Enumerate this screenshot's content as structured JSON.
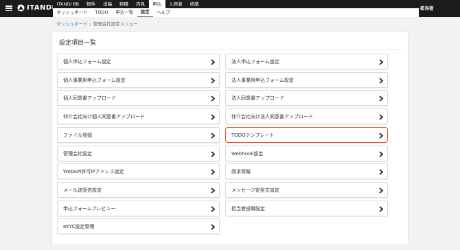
{
  "header": {
    "logo_text": "ITANDI",
    "top_tabs": [
      {
        "label": "ITANDI BB",
        "active": false
      },
      {
        "label": "物件",
        "active": false
      },
      {
        "label": "出稿",
        "active": false
      },
      {
        "label": "物確",
        "active": false
      },
      {
        "label": "内見",
        "active": false
      },
      {
        "label": "申込",
        "active": true
      },
      {
        "label": "入居者",
        "active": false
      },
      {
        "label": "修繕",
        "active": false
      }
    ],
    "sub_tabs": [
      {
        "label": "ダッシュボード",
        "active": false
      },
      {
        "label": "TODO",
        "active": false
      },
      {
        "label": "申込一覧",
        "active": false
      },
      {
        "label": "設定",
        "active": true
      },
      {
        "label": "ヘルプ",
        "active": false
      }
    ],
    "user_label": "担当者"
  },
  "breadcrumb": {
    "link": "ダッシュボード",
    "separator": "/",
    "current": "管理会社設定メニュー"
  },
  "panel": {
    "title": "設定項目一覧",
    "items_left": [
      "個人申込フォーム設定",
      "個人事業用申込フォーム設定",
      "個人同意書アップロード",
      "仲介会社向け個人同意書アップロード",
      "ファイル登録",
      "管理会社設定",
      "WebAPI許可IPアドレス設定",
      "メール送受信設定",
      "申込フォームプレビュー",
      "eKYC設定管理"
    ],
    "items_right": [
      "法人申込フォーム設定",
      "法人事業用申込フォーム設定",
      "法人同意書アップロード",
      "仲介会社向け法人同意書アップロード",
      "TODOテンプレート",
      "Webhook設定",
      "請求情報",
      "メッセージ定型文設定",
      "担当者役職設定"
    ],
    "highlighted_item": "TODOテンプレート",
    "item_icon": "chevron-right-icon"
  },
  "colors": {
    "header_bg": "#1c1c1c",
    "link": "#3b82c4",
    "highlight_border": "#e0542f"
  }
}
